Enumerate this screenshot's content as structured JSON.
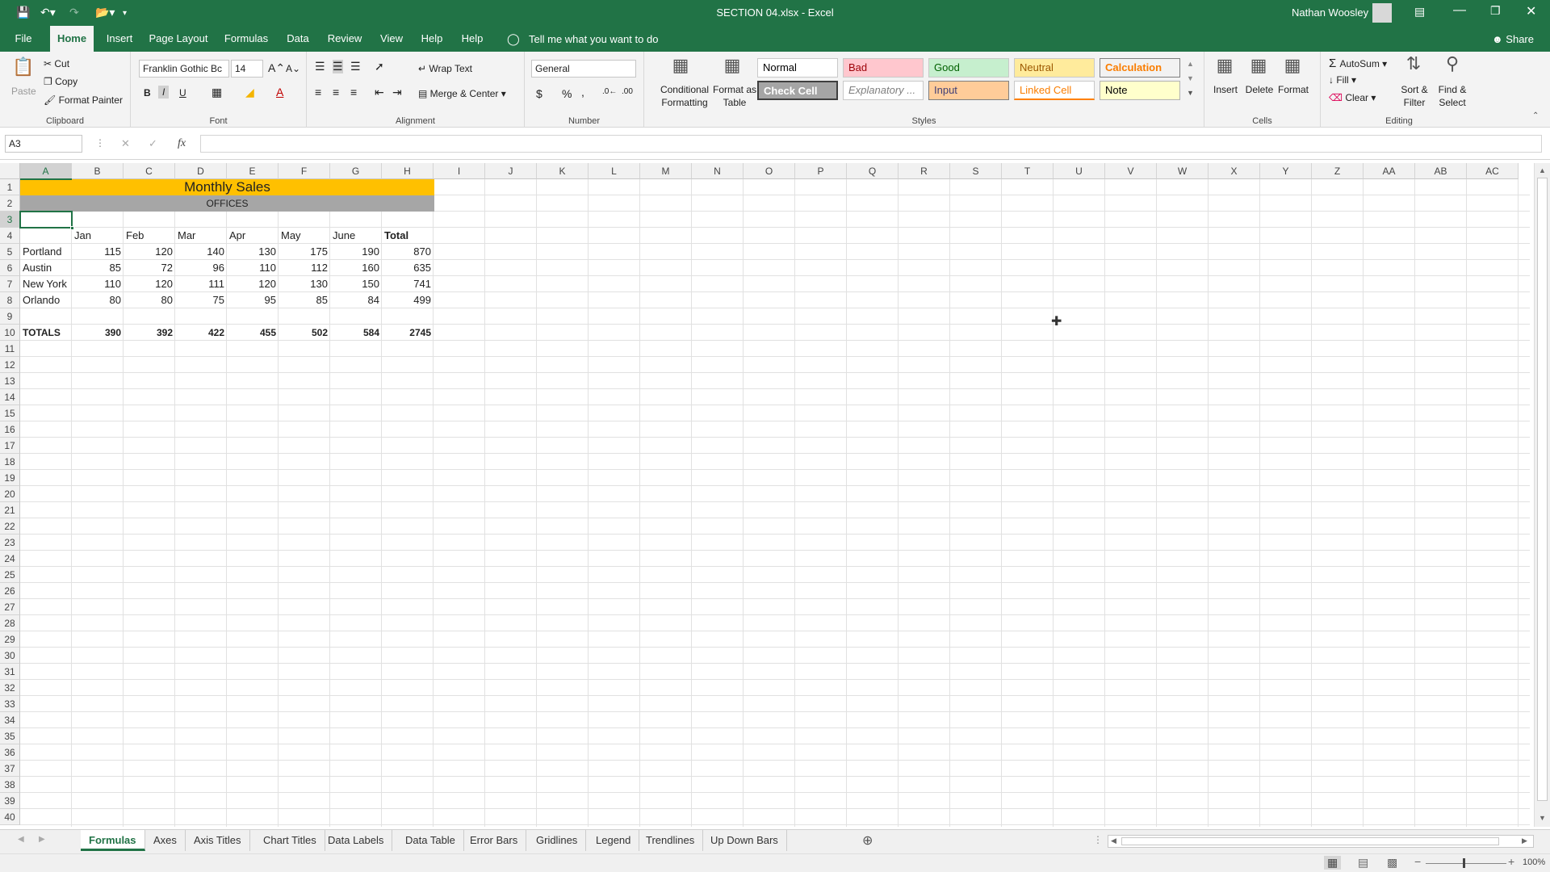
{
  "window": {
    "title": "SECTION 04.xlsx  -  Excel",
    "user": "Nathan Woosley"
  },
  "tabs": [
    "File",
    "Home",
    "Insert",
    "Page Layout",
    "Formulas",
    "Data",
    "Review",
    "View",
    "Help",
    "Help"
  ],
  "tell_me": "Tell me what you want to do",
  "share": "Share",
  "ribbon": {
    "clipboard": {
      "paste": "Paste",
      "cut": "Cut",
      "copy": "Copy",
      "format_painter": "Format Painter",
      "label": "Clipboard"
    },
    "font": {
      "name": "Franklin Gothic Bc",
      "size": "14",
      "label": "Font",
      "bold": "B",
      "italic": "I",
      "underline": "U"
    },
    "alignment": {
      "wrap": "Wrap Text",
      "merge": "Merge & Center",
      "label": "Alignment"
    },
    "number": {
      "format": "General",
      "label": "Number",
      "currency": "$",
      "percent": "%",
      "comma": ","
    },
    "cond_format": {
      "line1": "Conditional",
      "line2": "Formatting"
    },
    "format_table": {
      "line1": "Format as",
      "line2": "Table"
    },
    "styles": {
      "label": "Styles",
      "normal": "Normal",
      "bad": "Bad",
      "good": "Good",
      "neutral": "Neutral",
      "calculation": "Calculation",
      "check_cell": "Check Cell",
      "explanatory": "Explanatory ...",
      "input": "Input",
      "linked_cell": "Linked Cell",
      "note": "Note"
    },
    "cells": {
      "insert": "Insert",
      "delete": "Delete",
      "format": "Format",
      "label": "Cells"
    },
    "editing": {
      "autosum": "AutoSum",
      "fill": "Fill",
      "clear": "Clear",
      "sort1": "Sort &",
      "sort2": "Filter",
      "find1": "Find &",
      "find2": "Select",
      "label": "Editing"
    }
  },
  "formula_bar": {
    "name_box": "A3",
    "fx": "fx",
    "value": ""
  },
  "columns": [
    "A",
    "B",
    "C",
    "D",
    "E",
    "F",
    "G",
    "H",
    "I",
    "J",
    "K",
    "L",
    "M",
    "N",
    "O",
    "P",
    "Q",
    "R",
    "S",
    "T",
    "U",
    "V",
    "W",
    "X",
    "Y",
    "Z",
    "AA",
    "AB",
    "AC"
  ],
  "rows": [
    "1",
    "2",
    "3",
    "4",
    "5",
    "6",
    "7",
    "8",
    "9",
    "10",
    "11",
    "12",
    "13",
    "14",
    "15",
    "16",
    "17",
    "18",
    "19",
    "20",
    "21",
    "22",
    "23",
    "24",
    "25",
    "26",
    "27",
    "28",
    "29",
    "30",
    "31",
    "32",
    "33",
    "34",
    "35",
    "36",
    "37",
    "38",
    "39",
    "40"
  ],
  "sheet": {
    "title": "Monthly Sales",
    "subtitle": "OFFICES",
    "headers": [
      "Jan",
      "Feb",
      "Mar",
      "Apr",
      "May",
      "June",
      "Total"
    ],
    "data": [
      {
        "office": "Portland",
        "values": [
          "115",
          "120",
          "140",
          "130",
          "175",
          "190",
          "870"
        ]
      },
      {
        "office": "Austin",
        "values": [
          "85",
          "72",
          "96",
          "110",
          "112",
          "160",
          "635"
        ]
      },
      {
        "office": "New York",
        "values": [
          "110",
          "120",
          "111",
          "120",
          "130",
          "150",
          "741"
        ]
      },
      {
        "office": "Orlando",
        "values": [
          "80",
          "80",
          "75",
          "95",
          "85",
          "84",
          "499"
        ]
      }
    ],
    "totals_label": "TOTALS",
    "totals": [
      "390",
      "392",
      "422",
      "455",
      "502",
      "584",
      "2745"
    ]
  },
  "sheet_tabs": [
    "Formulas",
    "Axes",
    "Axis Titles",
    "Chart Titles",
    "Data Labels",
    "Data Table",
    "Error Bars",
    "Gridlines",
    "Legend",
    "Trendlines",
    "Up Down Bars"
  ],
  "status": {
    "zoom": "100%"
  },
  "colors": {
    "excel_green": "#217346",
    "title_fill": "#ffc000",
    "offices_fill": "#a6a6a6"
  }
}
